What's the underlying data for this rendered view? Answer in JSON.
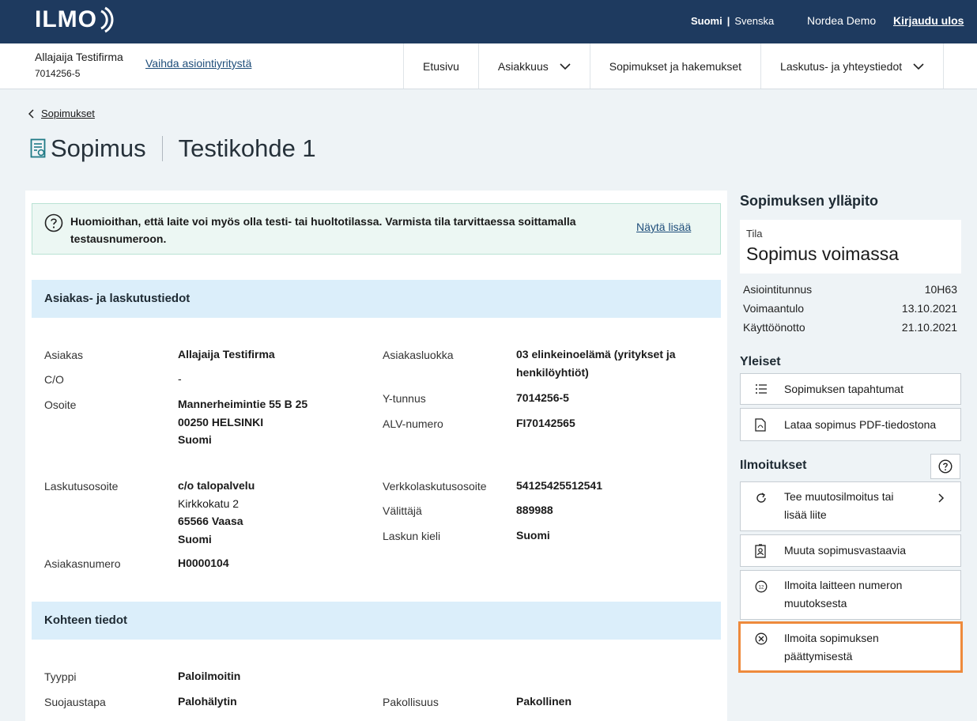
{
  "header": {
    "logo": "ILMO",
    "lang_active": "Suomi",
    "lang_sep": "|",
    "lang_other": "Svenska",
    "user": "Nordea Demo",
    "logout": "Kirjaudu ulos"
  },
  "subnav": {
    "company_name": "Allajaija Testifirma",
    "company_id": "7014256-5",
    "switch_link": "Vaihda asiointiyritystä",
    "tabs": [
      "Etusivu",
      "Asiakkuus",
      "Sopimukset ja hakemukset",
      "Laskutus- ja yhteystiedot"
    ]
  },
  "page": {
    "back_link": "Sopimukset",
    "title": "Sopimus",
    "subtitle": "Testikohde 1"
  },
  "notice": {
    "text": "Huomioithan, että laite voi myös olla testi- tai huoltotilassa. Varmista tila tarvittaessa soittamalla testausnumeroon.",
    "more": "Näytä lisää"
  },
  "customer": {
    "section_title": "Asiakas- ja laskutustiedot",
    "asiakas_label": "Asiakas",
    "asiakas": "Allajaija Testifirma",
    "co_label": "C/O",
    "co": "-",
    "osoite_label": "Osoite",
    "osoite": [
      "Mannerheimintie 55 B 25",
      "00250 HELSINKI",
      "Suomi"
    ],
    "laskutusosoite_label": "Laskutusosoite",
    "laskutusosoite": [
      "c/o talopalvelu",
      "Kirkkokatu 2",
      "65566 Vaasa",
      "Suomi"
    ],
    "asiakasnumero_label": "Asiakasnumero",
    "asiakasnumero": "H0000104",
    "asiakasluokka_label": "Asiakasluokka",
    "asiakasluokka": [
      "03 elinkeinoelämä (yritykset ja",
      "henkilöyhtiöt)"
    ],
    "ytunnus_label": "Y-tunnus",
    "ytunnus": "7014256-5",
    "alv_label": "ALV-numero",
    "alv": "FI70142565",
    "verkko_label": "Verkkolaskutusosoite",
    "verkko": "54125425512541",
    "valittaja_label": "Välittäjä",
    "valittaja": "889988",
    "kieli_label": "Laskun kieli",
    "kieli": "Suomi"
  },
  "target": {
    "section_title": "Kohteen tiedot",
    "tyyppi_label": "Tyyppi",
    "tyyppi": "Paloilmoitin",
    "suojaus_label": "Suojaustapa",
    "suojaus": "Palohälytin",
    "pakollisuus_label": "Pakollisuus",
    "pakollisuus": "Pakollinen"
  },
  "sidebar": {
    "title": "Sopimuksen ylläpito",
    "status_label": "Tila",
    "status_value": "Sopimus voimassa",
    "info": [
      {
        "label": "Asiointitunnus",
        "value": "10H63"
      },
      {
        "label": "Voimaantulo",
        "value": "13.10.2021"
      },
      {
        "label": "Käyttöönotto",
        "value": "21.10.2021"
      }
    ],
    "general_title": "Yleiset",
    "general_actions": [
      "Sopimuksen tapahtumat",
      "Lataa sopimus PDF-tiedostona"
    ],
    "notifications_title": "Ilmoitukset",
    "notification_actions": [
      [
        "Tee muutosilmoitus tai",
        "lisää liite"
      ],
      [
        "Muuta sopimusvastaavia"
      ],
      [
        "Ilmoita laitteen numeron",
        "muutoksesta"
      ],
      [
        "Ilmoita sopimuksen",
        "päättymisestä"
      ]
    ]
  },
  "colors": {
    "header_bg": "#1e3a5f",
    "section_bg": "#dbeefa",
    "notice_bg": "#ecf7f3",
    "highlight": "#ee8a3c"
  }
}
